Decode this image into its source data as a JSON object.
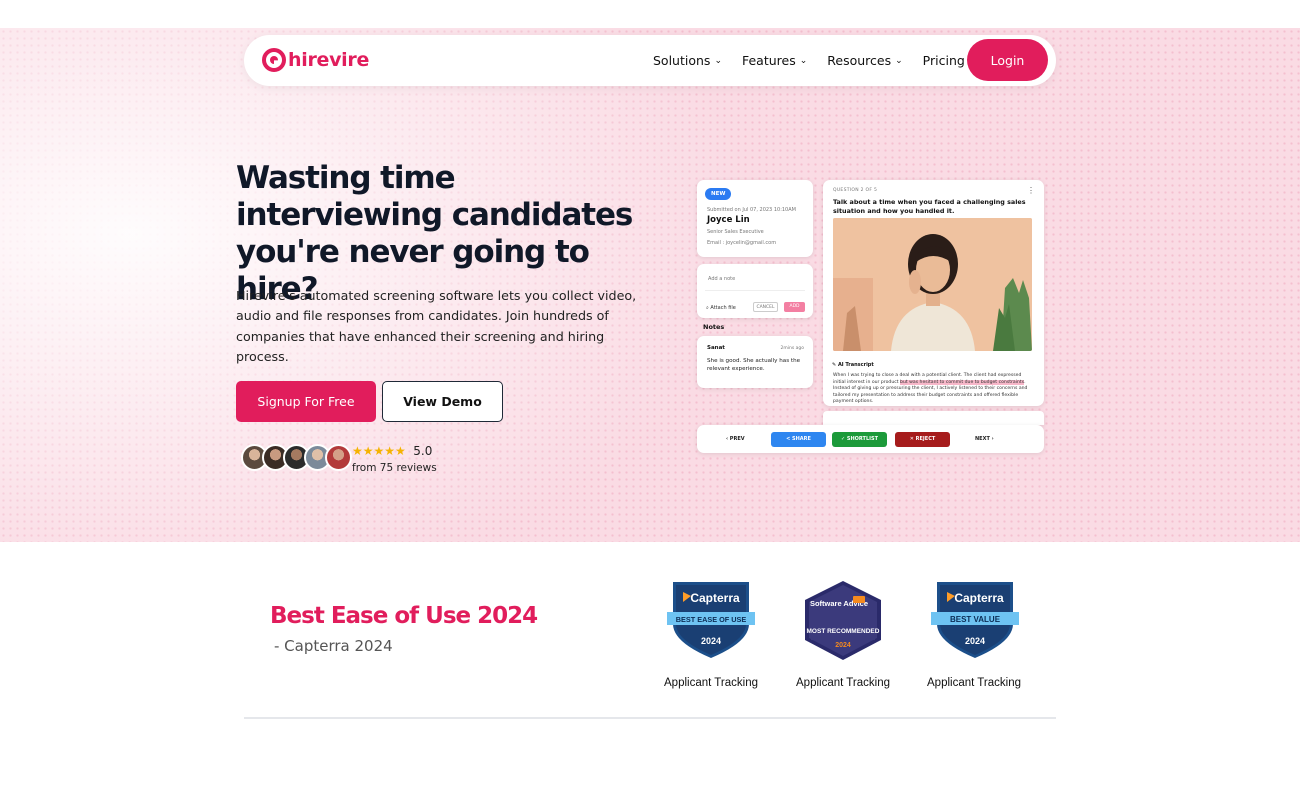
{
  "brand": {
    "name": "hirevire",
    "color": "#e11d5c"
  },
  "nav": {
    "links": [
      {
        "label": "Solutions",
        "has_dropdown": true
      },
      {
        "label": "Features",
        "has_dropdown": true
      },
      {
        "label": "Resources",
        "has_dropdown": true
      },
      {
        "label": "Pricing",
        "has_dropdown": false
      }
    ],
    "login_label": "Login"
  },
  "hero": {
    "headline": "Wasting time interviewing candidates you're never going to hire?",
    "subtext": "Hirevire's automated screening software lets you collect video, audio and file responses from candidates. Join hundreds of companies that have enhanced their screening and hiring process.",
    "signup_label": "Signup For Free",
    "demo_label": "View Demo",
    "rating": {
      "stars": "★★★★★",
      "score": "5.0",
      "reviews": "from 75 reviews"
    }
  },
  "mockup": {
    "candidate": {
      "badge": "NEW",
      "submitted": "Submitted on Jul 07, 2023 10:10AM",
      "name": "Joyce Lin",
      "title": "Senior Sales Executive",
      "email": "Email : joycelin@gmail.com"
    },
    "note_input": {
      "placeholder": "Add a note",
      "attach_label": "Attach file",
      "cancel_label": "CANCEL",
      "add_label": "ADD"
    },
    "notes": {
      "heading": "Notes",
      "author": "Sanat",
      "time": "2mins ago",
      "text": "She is good. She actually has the relevant experience."
    },
    "question": {
      "counter": "QUESTION 2 OF 5",
      "text": "Talk about a time when you faced a challenging sales situation and how you handled it.",
      "transcript_label": "AI Transcript",
      "transcript_before": "When I was trying to close a deal with a potential client. The client had expressed initial interest in our product ",
      "transcript_highlight": "but was hesitant to commit due to budget constraints",
      "transcript_after": ". Instead of giving up or pressuring the client, I actively listened to their concerns and tailored my presentation to address their budget constraints and offered flexible payment options."
    },
    "actions": {
      "prev": "‹ PREV",
      "share": "SHARE",
      "shortlist": "SHORTLIST",
      "reject": "REJECT",
      "next": "NEXT ›"
    }
  },
  "awards": {
    "title": "Best Ease of Use 2024",
    "subtitle": "- Capterra 2024",
    "badges": [
      {
        "brand": "Capterra",
        "ribbon": "BEST EASE OF USE",
        "year": "2024",
        "label": "Applicant Tracking"
      },
      {
        "brand": "Software Advice",
        "ribbon": "MOST RECOMMENDED",
        "year": "2024",
        "label": "Applicant Tracking"
      },
      {
        "brand": "Capterra",
        "ribbon": "BEST VALUE",
        "year": "2024",
        "label": "Applicant Tracking"
      }
    ]
  }
}
